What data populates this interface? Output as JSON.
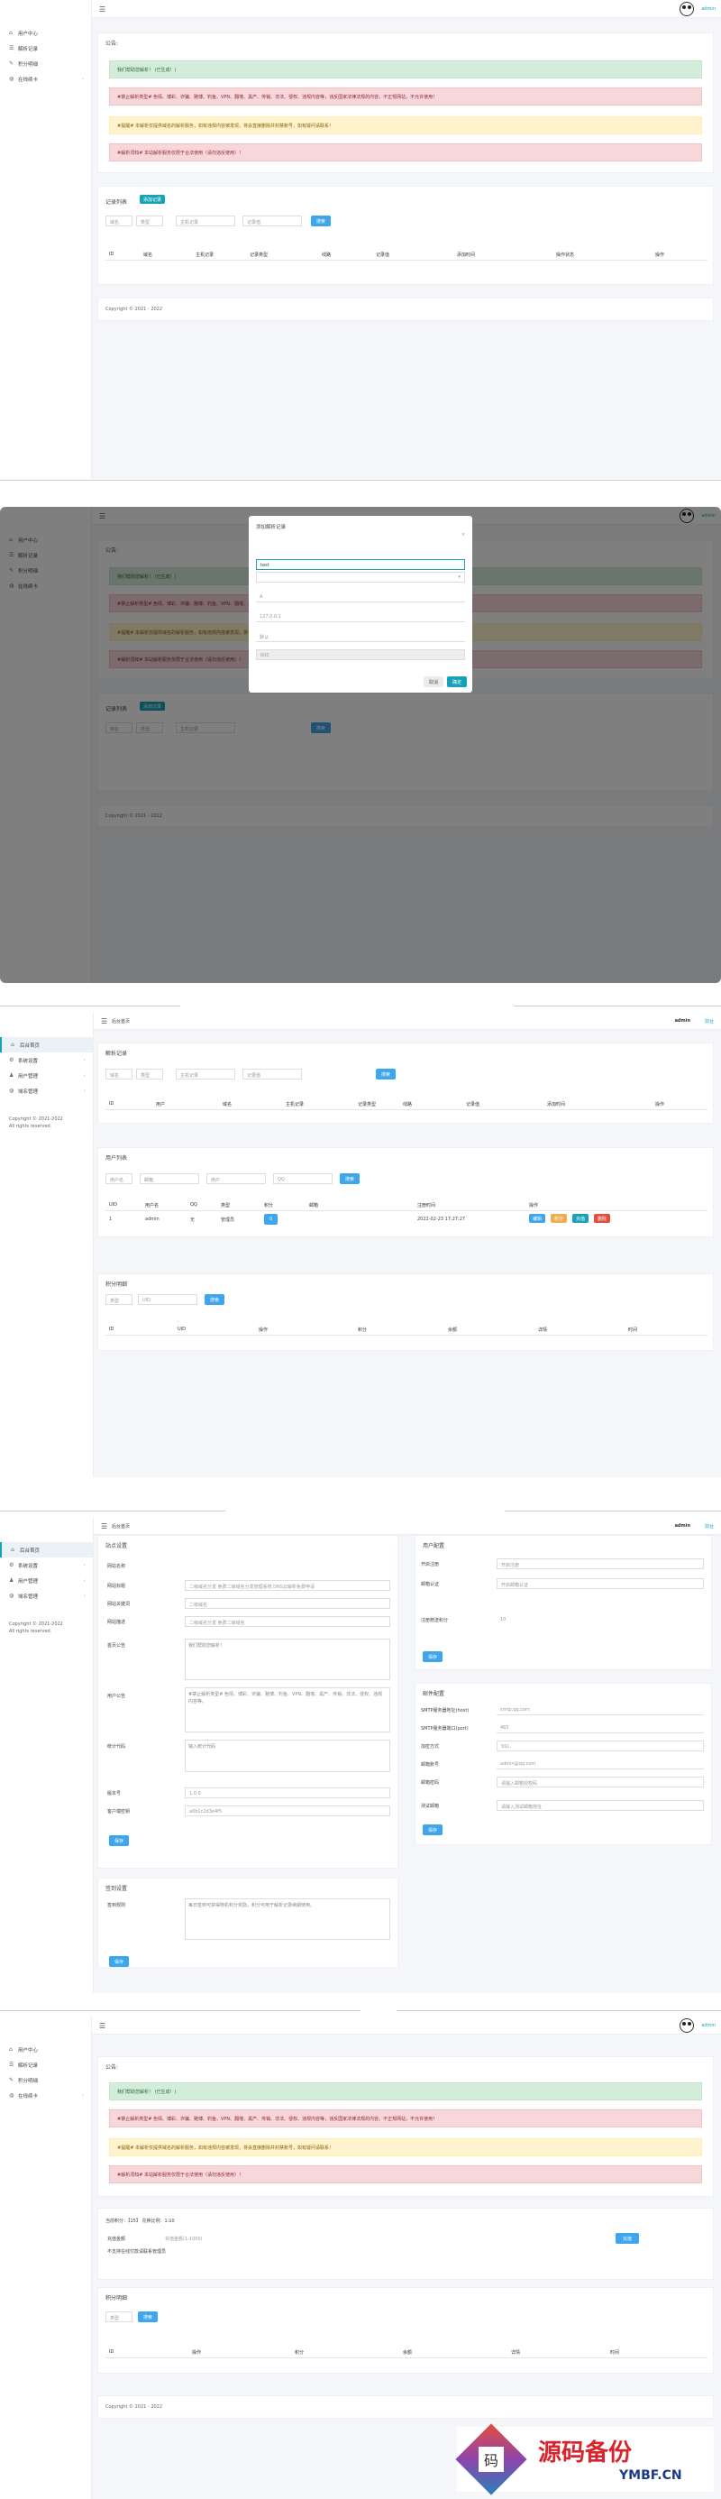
{
  "app": {
    "user": "admin",
    "copyright": "Copyright © 2021 - 2022",
    "copyright_short": "Copyright © 2021-2022",
    "rights": "All rights reserved."
  },
  "user_menu": [
    {
      "icon": "home-icon",
      "label": "用户中心"
    },
    {
      "icon": "list-icon",
      "label": "解析记录"
    },
    {
      "icon": "edit-icon",
      "label": "积分明细"
    },
    {
      "icon": "globe-icon",
      "label": "在线续卡"
    }
  ],
  "admin_menu": [
    {
      "icon": "home-icon",
      "label": "后台首页"
    },
    {
      "icon": "gear-icon",
      "label": "系统设置"
    },
    {
      "icon": "user-icon",
      "label": "用户管理"
    },
    {
      "icon": "globe-icon",
      "label": "域名管理"
    }
  ],
  "notice": {
    "title": "公告:",
    "green": "我们帮助您解析！ (已生成！)",
    "red1": "#禁止解析类型# 色情、博彩、诈骗、赌博、钓鱼、VPN、翻墙、黑产、传销、非法、侵权、违规内容等，违反国家法律法规的内容。不正规网站，不允许使用！",
    "yellow": "#提醒# 本解析仅提供域名的解析服务，如有违规内容被发现，将会直接删除并封禁账号，如有疑问请联系！",
    "red2": "#解析须知# 本站解析服务仅限于合法使用（请勿违反使用）！"
  },
  "records": {
    "title": "记录列表",
    "add_button": "添加记录",
    "filter1": "域名",
    "filter2": "类型",
    "search_ph": "主机记录",
    "value_ph": "记录值",
    "search_btn": "搜索",
    "columns": [
      "ID",
      "域名",
      "主机记录",
      "记录类型",
      "线路",
      "记录值",
      "添加时间",
      "操作状态",
      "操作"
    ]
  },
  "modal": {
    "title": "添加解析记录",
    "host_value": "test",
    "type_value": "A",
    "ip_value": "127.0.0.1",
    "line_value": "默认",
    "ttl_value": "600",
    "cancel": "取消",
    "confirm": "确定"
  },
  "admin_home": {
    "title": "后台首页",
    "top_link": "前台",
    "records_title": "解析记录",
    "records_search_ph": "主机记录",
    "records_columns": [
      "ID",
      "用户",
      "域名",
      "主机记录",
      "记录类型",
      "线路",
      "记录值",
      "添加时间",
      "操作"
    ],
    "users_title": "用户列表",
    "users_filter": "用户名",
    "users_ph": "邮箱",
    "users_ph2": "用户",
    "users_ph3": "QQ",
    "users_search": "搜索",
    "users_columns": [
      "UID",
      "用户名",
      "QQ",
      "类型",
      "积分",
      "邮箱",
      "注册时间",
      "操作"
    ],
    "user_row": {
      "uid": "1",
      "name": "admin",
      "qq": "无",
      "type": "管理员",
      "points": "0",
      "email": "",
      "time": "2022-02-23 17:27:27",
      "actions": [
        "编辑",
        "积分",
        "充值",
        "删除"
      ]
    },
    "points_title": "积分明细",
    "points_ph": "UID",
    "points_columns": [
      "ID",
      "UID",
      "操作",
      "积分",
      "余额",
      "详情",
      "时间"
    ]
  },
  "settings": {
    "site_title": "站点设置",
    "site_rows": [
      {
        "label": "网站名称",
        "value": "二级域名分发"
      },
      {
        "label": "网站标题",
        "value": "二级域名分发 免费二级域名分发管理系统 DNS云解析免费申请"
      },
      {
        "label": "网站关键词",
        "value": "二级域名"
      },
      {
        "label": "网站描述",
        "value": "二级域名分发 免费二级域名"
      },
      {
        "label": "首页公告",
        "value": "我们帮助您解析！"
      },
      {
        "label": "用户公告",
        "value": "#禁止解析类型# 色情、博彩、诈骗、赌博、钓鱼、VPN、翻墙、黑产、传销、非法、侵权、违规内容等。"
      },
      {
        "label": "统计代码",
        "value": "输入统计代码"
      },
      {
        "label": "版本号",
        "value": "1.0.0"
      },
      {
        "label": "客户端密钥",
        "value": "a0b1c2d3e4f5"
      }
    ],
    "sign_title": "签到设置",
    "sign_label": "签到规则",
    "sign_value": "每日签到可获得随机积分奖励，积分可用于解析记录续期使用。",
    "save": "保存",
    "user_title": "用户配置",
    "user_rows": [
      {
        "label": "开启注册",
        "value": "开启注册"
      },
      {
        "label": "邮箱认证",
        "value": "开启邮箱认证"
      },
      {
        "label": "注册赠送积分",
        "value": "10"
      }
    ],
    "mail_title": "邮件配置",
    "mail_rows": [
      {
        "label": "SMTP服务器地址(host)",
        "value": "smtp.qq.com"
      },
      {
        "label": "SMTP服务器端口(port)",
        "value": "465"
      },
      {
        "label": "加密方式",
        "value": "SSL"
      },
      {
        "label": "邮箱账号",
        "value": "admin@qq.com"
      },
      {
        "label": "邮箱密码",
        "value": "请输入邮箱授权码"
      },
      {
        "label": "测试邮箱",
        "value": "请输入测试邮箱地址"
      }
    ]
  },
  "renew": {
    "info": "当前积分：【15】 兑换比例：1:10",
    "label": "充值金额",
    "ph": "充值金额(1-1000)",
    "btn": "充值",
    "hint": "不支持在线付款请联系管理员",
    "points_title": "积分明细",
    "filter": "类型",
    "search": "搜索",
    "columns": [
      "ID",
      "操作",
      "积分",
      "余额",
      "详情",
      "时间"
    ]
  },
  "watermark": {
    "title": "源码备份",
    "url": "YMBF.CN",
    "glyph": "码"
  },
  "colors": {
    "primary": "#3ea6ec",
    "teal": "#17a2b8",
    "success": "#d4edda",
    "danger": "#f8d7da",
    "warning": "#fff3cd"
  }
}
